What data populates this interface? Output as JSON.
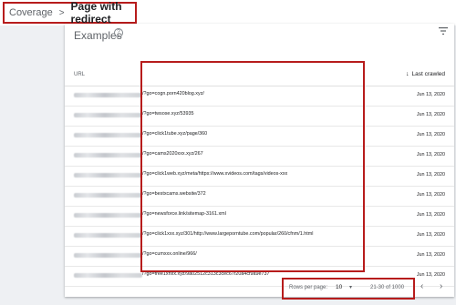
{
  "breadcrumb": {
    "root": "Coverage",
    "separator": ">",
    "current": "Page with redirect"
  },
  "card": {
    "title": "Examples",
    "help_icon": "help-circle-icon",
    "filter_icon": "filter-icon"
  },
  "table": {
    "columns": {
      "url": "URL",
      "last_crawled": "Last crawled",
      "sort_icon": "arrow-down-icon"
    },
    "rows": [
      {
        "url_suffix": "/?go=cogn.porn420blog.xyz/",
        "date": "Jun 13, 2020"
      },
      {
        "url_suffix": "/?go=twsose.xyz/53935",
        "date": "Jun 13, 2020"
      },
      {
        "url_suffix": "/?go=click1tube.xyz/page/360",
        "date": "Jun 13, 2020"
      },
      {
        "url_suffix": "/?go=cams2020xxx.xyz/267",
        "date": "Jun 13, 2020"
      },
      {
        "url_suffix": "/?go=click1web.xyz/meta/https://www.xvideos.com/tags/videos-xxx",
        "date": "Jun 13, 2020"
      },
      {
        "url_suffix": "/?go=bestxcams.website/372",
        "date": "Jun 13, 2020"
      },
      {
        "url_suffix": "/?go=newsforce.link/sitemap-3161.xml",
        "date": "Jun 13, 2020"
      },
      {
        "url_suffix": "/?go=click1xxx.xyz/301/http://www.largeporntube.com/popular/260/cfnm/1.html",
        "date": "Jun 13, 2020"
      },
      {
        "url_suffix": "/?go=cumxxx.online/966/",
        "date": "Jun 13, 2020"
      },
      {
        "url_suffix": "/?go=free1xnxx.xyz/9a02512c313c3cec67f20a4cf9a9e737",
        "date": "Jun 13, 2020"
      }
    ]
  },
  "pagination": {
    "rows_per_page_label": "Rows per page:",
    "rows_per_page_value": "10",
    "range": "21-30 of 1000",
    "prev_icon": "chevron-left-icon",
    "next_icon": "chevron-right-icon"
  },
  "colors": {
    "annotation_red": "#b71c1c",
    "background": "#eef0f3"
  }
}
